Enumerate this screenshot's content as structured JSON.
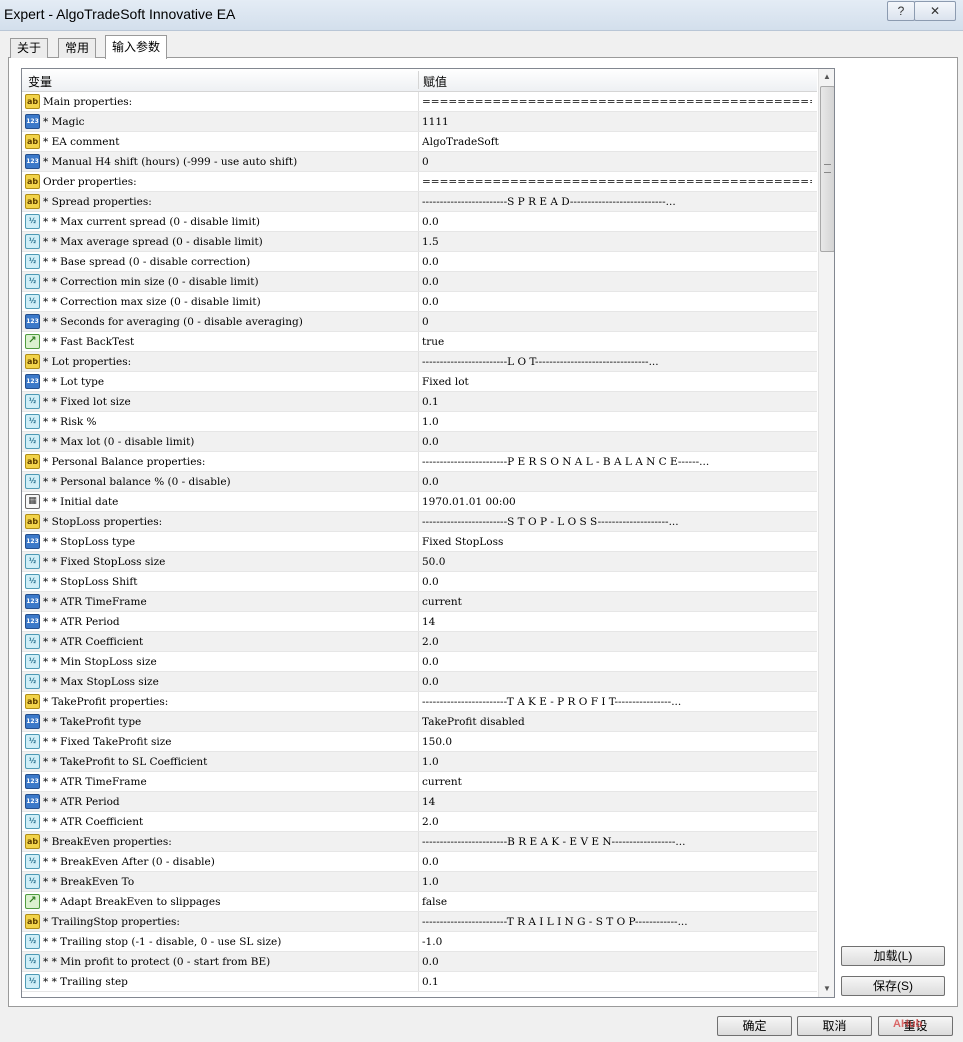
{
  "window": {
    "title": "Expert - AlgoTradeSoft Innovative EA",
    "help_label": "?",
    "close_label": "✕"
  },
  "tabs": [
    {
      "label": "关于"
    },
    {
      "label": "常用"
    },
    {
      "label": "输入参数"
    }
  ],
  "grid": {
    "headers": {
      "name": "变量",
      "value": "赋值"
    },
    "rows": [
      {
        "icon": "str",
        "name": "Main properties:",
        "value": "================================================================..."
      },
      {
        "icon": "int",
        "name": "* Magic",
        "value": "1111"
      },
      {
        "icon": "str",
        "name": "* EA comment",
        "value": "AlgoTradeSoft"
      },
      {
        "icon": "int",
        "name": "* Manual H4 shift (hours) (-999 - use auto shift)",
        "value": "0"
      },
      {
        "icon": "str",
        "name": "Order properties:",
        "value": "================================================================..."
      },
      {
        "icon": "str",
        "name": "* Spread properties:",
        "value": "------------------------S P R E A D---------------------------..."
      },
      {
        "icon": "dbl",
        "name": "* * Max current spread (0 - disable limit)",
        "value": "0.0"
      },
      {
        "icon": "dbl",
        "name": "* * Max average spread (0 - disable limit)",
        "value": "1.5"
      },
      {
        "icon": "dbl",
        "name": "* * Base spread (0 - disable correction)",
        "value": "0.0"
      },
      {
        "icon": "dbl",
        "name": "* * Correction min size (0 - disable limit)",
        "value": "0.0"
      },
      {
        "icon": "dbl",
        "name": "* * Correction max size (0 - disable limit)",
        "value": "0.0"
      },
      {
        "icon": "int",
        "name": "* * Seconds for averaging (0 - disable averaging)",
        "value": "0"
      },
      {
        "icon": "bool",
        "name": "* * Fast BackTest",
        "value": "true"
      },
      {
        "icon": "str",
        "name": "* Lot properties:",
        "value": "------------------------L O T--------------------------------..."
      },
      {
        "icon": "int",
        "name": "* * Lot type",
        "value": "Fixed lot"
      },
      {
        "icon": "dbl",
        "name": "* * Fixed lot size",
        "value": "0.1"
      },
      {
        "icon": "dbl",
        "name": "* * Risk %",
        "value": "1.0"
      },
      {
        "icon": "dbl",
        "name": "* * Max lot (0 - disable limit)",
        "value": "0.0"
      },
      {
        "icon": "str",
        "name": "* Personal Balance properties:",
        "value": "------------------------P E R S O N A L - B A L A N C E------..."
      },
      {
        "icon": "dbl",
        "name": "* * Personal balance % (0 - disable)",
        "value": "0.0"
      },
      {
        "icon": "date",
        "name": "* * Initial date",
        "value": "1970.01.01 00:00"
      },
      {
        "icon": "str",
        "name": "* StopLoss properties:",
        "value": "------------------------S T O P - L O S S--------------------..."
      },
      {
        "icon": "int",
        "name": "* * StopLoss type",
        "value": "Fixed StopLoss"
      },
      {
        "icon": "dbl",
        "name": "* * Fixed StopLoss size",
        "value": "50.0"
      },
      {
        "icon": "dbl",
        "name": "* * StopLoss Shift",
        "value": "0.0"
      },
      {
        "icon": "int",
        "name": "* * ATR TimeFrame",
        "value": "current"
      },
      {
        "icon": "int",
        "name": "* * ATR Period",
        "value": "14"
      },
      {
        "icon": "dbl",
        "name": "* * ATR Coefficient",
        "value": "2.0"
      },
      {
        "icon": "dbl",
        "name": "* * Min StopLoss size",
        "value": "0.0"
      },
      {
        "icon": "dbl",
        "name": "* * Max StopLoss size",
        "value": "0.0"
      },
      {
        "icon": "str",
        "name": "* TakeProfit properties:",
        "value": "------------------------T A K E - P R O F I T----------------..."
      },
      {
        "icon": "int",
        "name": "* * TakeProfit type",
        "value": "TakeProfit disabled"
      },
      {
        "icon": "dbl",
        "name": "* * Fixed TakeProfit size",
        "value": "150.0"
      },
      {
        "icon": "dbl",
        "name": "* * TakeProfit to SL Coefficient",
        "value": "1.0"
      },
      {
        "icon": "int",
        "name": "* * ATR TimeFrame",
        "value": "current"
      },
      {
        "icon": "int",
        "name": "* * ATR Period",
        "value": "14"
      },
      {
        "icon": "dbl",
        "name": "* * ATR Coefficient",
        "value": "2.0"
      },
      {
        "icon": "str",
        "name": "* BreakEven properties:",
        "value": "------------------------B R E A K - E V E N------------------..."
      },
      {
        "icon": "dbl",
        "name": "* * BreakEven After (0 - disable)",
        "value": "0.0"
      },
      {
        "icon": "dbl",
        "name": "* * BreakEven To",
        "value": "1.0"
      },
      {
        "icon": "bool",
        "name": "* * Adapt BreakEven to slippages",
        "value": "false"
      },
      {
        "icon": "str",
        "name": "* TrailingStop properties:",
        "value": "------------------------T R A I L I N G - S T O P------------..."
      },
      {
        "icon": "dbl",
        "name": "* * Trailing stop (-1 - disable, 0 - use SL size)",
        "value": "-1.0"
      },
      {
        "icon": "dbl",
        "name": "* * Min profit to protect (0 - start from BE)",
        "value": "0.0"
      },
      {
        "icon": "dbl",
        "name": "* * Trailing step",
        "value": "0.1"
      }
    ]
  },
  "icon_labels": {
    "str": "ab",
    "int": "123",
    "dbl": "½",
    "bool": "↗",
    "date": "▦"
  },
  "buttons": {
    "load": "加载(L)",
    "save": "保存(S)",
    "ok": "确定",
    "cancel": "取消",
    "reset": "重设"
  },
  "watermark": "AHub"
}
